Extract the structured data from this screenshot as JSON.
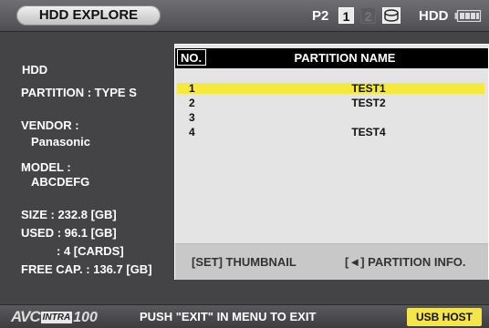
{
  "header": {
    "title": "HDD EXPLORE",
    "p2_label": "P2",
    "slot1": "1",
    "slot2": "2",
    "hdd_label": "HDD",
    "icons": [
      "hdd-drive-icon",
      "battery-icon"
    ]
  },
  "info": {
    "heading": "HDD",
    "partition": "PARTITION : TYPE S",
    "vendor_label": "VENDOR :",
    "vendor_value": "Panasonic",
    "model_label": "MODEL :",
    "model_value": "ABCDEFG",
    "size": "SIZE : 232.8 [GB]",
    "used": "USED :  96.1 [GB]",
    "used_cards": ": 4 [CARDS]",
    "free": "FREE CAP. : 136.7 [GB]"
  },
  "dialog": {
    "col_no": "NO.",
    "col_name": "PARTITION NAME",
    "rows": [
      {
        "no": "1",
        "name": "TEST1",
        "selected": true
      },
      {
        "no": "2",
        "name": "TEST2",
        "selected": false
      },
      {
        "no": "3",
        "name": "",
        "selected": false
      },
      {
        "no": "4",
        "name": "TEST4",
        "selected": false
      }
    ],
    "hint_thumbnail": "[SET] THUMBNAIL",
    "hint_partition": "[◄] PARTITION INFO."
  },
  "footer": {
    "logo_avc": "AVC",
    "logo_intra": "INTRA",
    "logo_rate": "100",
    "message": "PUSH \"EXIT\" IN MENU TO EXIT",
    "usb_host": "USB HOST"
  },
  "colors": {
    "background": "#444446",
    "selection": "#f5ea3c",
    "usb_button": "#f4e54a",
    "dialog_bg": "#e4e4e4"
  }
}
